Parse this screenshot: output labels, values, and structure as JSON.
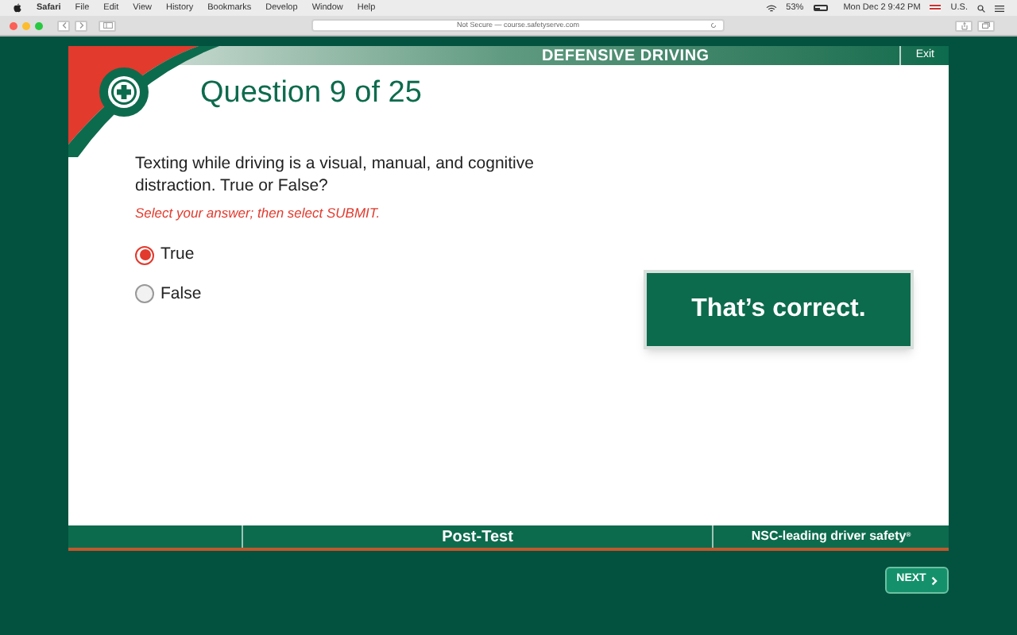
{
  "menubar": {
    "app": "Safari",
    "items": [
      "File",
      "Edit",
      "View",
      "History",
      "Bookmarks",
      "Develop",
      "Window",
      "Help"
    ],
    "battery": "53%",
    "clock": "Mon Dec 2  9:42 PM",
    "input_source": "U.S."
  },
  "browser": {
    "address": "Not Secure — course.safetyserve.com"
  },
  "course": {
    "title": "DEFENSIVE DRIVING",
    "exit": "Exit",
    "question_number": "Question 9 of 25",
    "question": "Texting while driving is a visual, manual, and cognitive distraction. True or False?",
    "instruction": "Select your answer; then select SUBMIT.",
    "options": [
      {
        "label": "True",
        "selected": true
      },
      {
        "label": "False",
        "selected": false
      }
    ],
    "feedback": "That’s correct.",
    "footer_section": "Post-Test",
    "footer_tagline": "NSC-leading driver safety",
    "footer_mark": "®"
  },
  "next_button": "NEXT"
}
